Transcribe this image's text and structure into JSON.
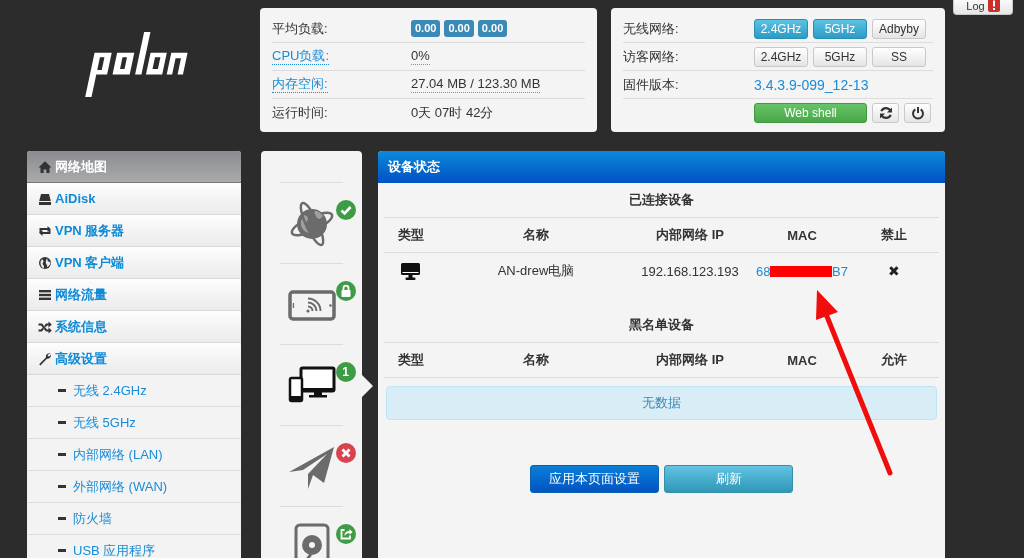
{
  "log_button": {
    "label": "Log",
    "alert": true
  },
  "system_card": {
    "rows": [
      {
        "kind": "badges",
        "label": "平均负载:",
        "badges": [
          "0.00",
          "0.00",
          "0.00"
        ]
      },
      {
        "kind": "link",
        "label": "CPU负载:",
        "value": "0%"
      },
      {
        "kind": "link",
        "label": "内存空闲:",
        "value": "27.04 MB / 123.30 MB"
      },
      {
        "kind": "plain",
        "label": "运行时间:",
        "value": "0天 07时 42分"
      }
    ]
  },
  "network_card": {
    "rows": [
      {
        "kind": "toggles",
        "label": "无线网络:",
        "buttons": [
          {
            "label": "2.4GHz",
            "on": true
          },
          {
            "label": "5GHz",
            "on": true
          },
          {
            "label": "Adbyby",
            "on": false
          }
        ]
      },
      {
        "kind": "toggles",
        "label": "访客网络:",
        "buttons": [
          {
            "label": "2.4GHz",
            "on": false
          },
          {
            "label": "5GHz",
            "on": false
          },
          {
            "label": "SS",
            "on": false
          }
        ]
      },
      {
        "kind": "version",
        "label": "固件版本:",
        "value": "3.4.3.9-099_12-13"
      },
      {
        "kind": "actions",
        "buttons": [
          {
            "kind": "web_shell",
            "label": "Web shell"
          },
          {
            "kind": "refresh"
          },
          {
            "kind": "power"
          }
        ]
      }
    ]
  },
  "sidebar": {
    "items": [
      {
        "label": "网络地图",
        "selected": true
      },
      {
        "label": "AiDisk",
        "selected": false
      },
      {
        "label": "VPN 服务器",
        "selected": false
      },
      {
        "label": "VPN 客户端",
        "selected": false
      },
      {
        "label": "网络流量",
        "selected": false
      },
      {
        "label": "系统信息",
        "selected": false
      },
      {
        "label": "高级设置",
        "selected": false,
        "expanded": true,
        "children": [
          {
            "label": "无线 2.4GHz",
            "selected": false
          },
          {
            "label": "无线 5GHz",
            "selected": false
          },
          {
            "label": "内部网络 (LAN)",
            "selected": false
          },
          {
            "label": "外部网络 (WAN)",
            "selected": false
          },
          {
            "label": "防火墙",
            "selected": false
          },
          {
            "label": "USB 应用程序",
            "selected": false
          }
        ]
      }
    ]
  },
  "status_rail": {
    "items": [
      {
        "kind": "globe",
        "selected": false
      },
      {
        "kind": "tablet",
        "selected": false
      },
      {
        "kind": "devices",
        "count": "1",
        "selected": true
      },
      {
        "kind": "plane",
        "selected": false
      },
      {
        "kind": "disk",
        "selected": false
      }
    ]
  },
  "device_panel": {
    "title": "设备状态",
    "sections": [
      {
        "title": "已连接设备",
        "columns": [
          "类型",
          "名称",
          "内部网络 IP",
          "MAC",
          "禁止"
        ],
        "rows": [
          {
            "kind": "computer",
            "name": "AN-drew电脑",
            "ip": "192.168.123.193",
            "mac": {
              "start": "68",
              "redacted": true,
              "end": "B7"
            },
            "action": "✖"
          }
        ]
      },
      {
        "title": "黑名单设备",
        "columns": [
          "类型",
          "名称",
          "内部网络 IP",
          "MAC",
          "允许"
        ],
        "empty_message": "无数据"
      }
    ],
    "buttons": [
      {
        "kind": "apply",
        "label": "应用本页面设置"
      },
      {
        "kind": "refresh",
        "label": "刷新"
      }
    ]
  },
  "annotations": [
    {
      "kind": "arrow"
    }
  ]
}
